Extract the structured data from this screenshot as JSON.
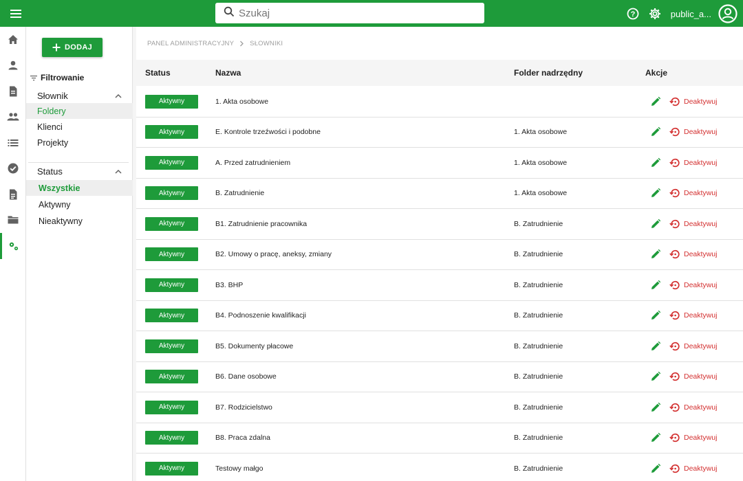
{
  "topbar": {
    "search_placeholder": "Szukaj",
    "username": "public_a...",
    "accent": "#1e9b3a"
  },
  "rail": {
    "items": [
      "home-icon",
      "person-icon",
      "document-icon",
      "people-icon",
      "list-icon",
      "check-circle-icon",
      "file-icon",
      "folder-icon",
      "settings-gears-icon"
    ]
  },
  "filters": {
    "add_label": "DODAJ",
    "title": "Filtrowanie",
    "dictionary": {
      "label": "Słownik",
      "options": [
        "Foldery",
        "Klienci",
        "Projekty"
      ],
      "selected": "Foldery"
    },
    "status": {
      "label": "Status",
      "options": [
        "Wszystkie",
        "Aktywny",
        "Nieaktywny"
      ],
      "selected": "Wszystkie"
    }
  },
  "breadcrumb": [
    "PANEL ADMINISTRACYJNY",
    "SŁOWNIKI"
  ],
  "table": {
    "headers": [
      "Status",
      "Nazwa",
      "Folder nadrzędny",
      "Akcje"
    ],
    "deactivate_label": "Deaktywuj",
    "rows": [
      {
        "status": "Aktywny",
        "name": "1. Akta osobowe",
        "parent": ""
      },
      {
        "status": "Aktywny",
        "name": "E. Kontrole trzeźwości i podobne",
        "parent": "1. Akta osobowe"
      },
      {
        "status": "Aktywny",
        "name": "A. Przed zatrudnieniem",
        "parent": "1. Akta osobowe"
      },
      {
        "status": "Aktywny",
        "name": "B. Zatrudnienie",
        "parent": "1. Akta osobowe"
      },
      {
        "status": "Aktywny",
        "name": "B1. Zatrudnienie pracownika",
        "parent": "B. Zatrudnienie"
      },
      {
        "status": "Aktywny",
        "name": "B2. Umowy o pracę, aneksy, zmiany",
        "parent": "B. Zatrudnienie"
      },
      {
        "status": "Aktywny",
        "name": "B3. BHP",
        "parent": "B. Zatrudnienie"
      },
      {
        "status": "Aktywny",
        "name": "B4. Podnoszenie kwalifikacji",
        "parent": "B. Zatrudnienie"
      },
      {
        "status": "Aktywny",
        "name": "B5. Dokumenty płacowe",
        "parent": "B. Zatrudnienie"
      },
      {
        "status": "Aktywny",
        "name": "B6. Dane osobowe",
        "parent": "B. Zatrudnienie"
      },
      {
        "status": "Aktywny",
        "name": "B7. Rodzicielstwo",
        "parent": "B. Zatrudnienie"
      },
      {
        "status": "Aktywny",
        "name": "B8. Praca zdalna",
        "parent": "B. Zatrudnienie"
      },
      {
        "status": "Aktywny",
        "name": "Testowy małgo",
        "parent": "B. Zatrudnienie"
      }
    ]
  }
}
